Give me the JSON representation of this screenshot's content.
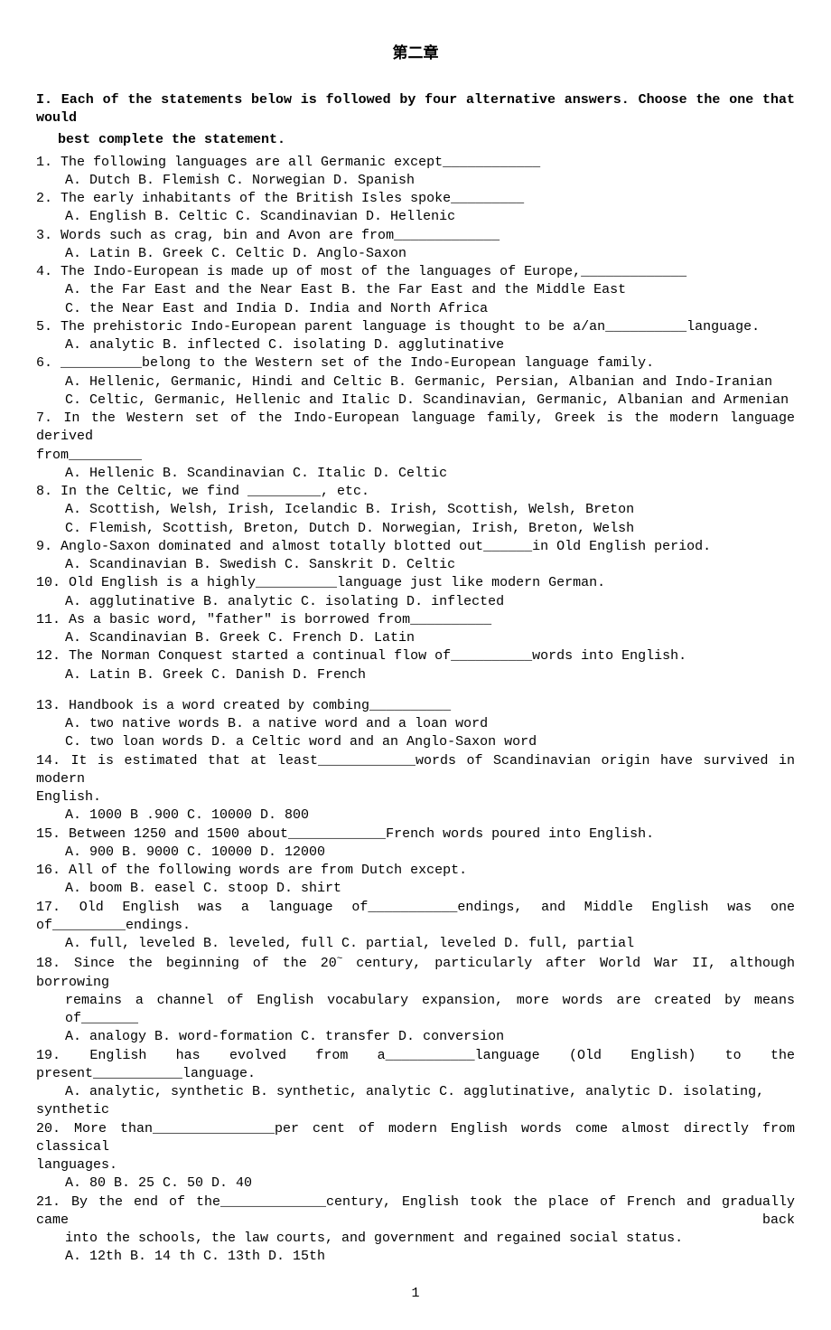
{
  "title": "第二章",
  "instructions_l1": "I. Each of the statements below is followed by four alternative answers. Choose the one that would",
  "instructions_l2": "best complete the statement.",
  "q1": {
    "stem": "1. The following languages are all Germanic except____________",
    "opts": "A. Dutch      B. Flemish       C. Norwegian      D. Spanish"
  },
  "q2": {
    "stem": "2. The early inhabitants of the British Isles spoke_________",
    "opts": "A. English     B. Celtic      C. Scandinavian     D. Hellenic"
  },
  "q3": {
    "stem": "3. Words such as crag, bin and Avon are from_____________",
    "opts": "A. Latin    B. Greek     C. Celtic    D. Anglo-Saxon"
  },
  "q4": {
    "stem": "4. The Indo-European is made up of most of the languages of Europe,_____________",
    "opts1": "A. the Far East and the Near East     B. the Far East and the Middle East",
    "opts2": "C. the Near East and India           D. India and North Africa"
  },
  "q5": {
    "stem": "5. The prehistoric Indo-European parent language is thought to be a/an__________language.",
    "opts": "A. analytic     B. inflected    C. isolating    D. agglutinative"
  },
  "q6": {
    "stem": "6. __________belong to the Western set of the Indo-European language family.",
    "opts1": "A. Hellenic, Germanic, Hindi and Celtic    B. Germanic, Persian, Albanian and Indo-Iranian",
    "opts2": "C. Celtic, Germanic, Hellenic and Italic   D. Scandinavian, Germanic, Albanian and Armenian"
  },
  "q7": {
    "stem1": "7. In the Western set of the Indo-European language family, Greek is the modern language derived",
    "stem2": "from_________",
    "opts": "A. Hellenic    B. Scandinavian    C. Italic    D. Celtic"
  },
  "q8": {
    "stem": "8. In the Celtic, we find _________, etc.",
    "opts1": "A. Scottish, Welsh, Irish, Icelandic     B. Irish, Scottish, Welsh, Breton",
    "opts2": "C. Flemish, Scottish, Breton, Dutch     D. Norwegian, Irish, Breton, Welsh"
  },
  "q9": {
    "stem": "9. Anglo-Saxon dominated  and  almost  totally  blotted  out______in Old English period.",
    "opts": "A. Scandinavian    B. Swedish    C. Sanskrit    D. Celtic"
  },
  "q10": {
    "stem": "10. Old English is a highly__________language just like modern German.",
    "opts": "A. agglutinative     B. analytic    C. isolating     D. inflected"
  },
  "q11": {
    "stem": "11. As a basic word, \"father\" is borrowed from__________",
    "opts": "A. Scandinavian     B. Greek     C. French     D. Latin"
  },
  "q12": {
    "stem": "12. The Norman Conquest started a continual flow of__________words into English.",
    "opts": "A. Latin     B. Greek     C. Danish     D. French"
  },
  "q13": {
    "stem": "13. Handbook is a word created by combing__________",
    "opts1": "A. two native words      B. a native word and a loan word",
    "opts2": "C. two loan words        D. a Celtic word and an Anglo-Saxon word"
  },
  "q14": {
    "stem1": "14. It is estimated that at least____________words of Scandinavian origin have survived in modern",
    "stem2": "English.",
    "opts": "A. 1000    B .900     C. 10000     D. 800"
  },
  "q15": {
    "stem": "15. Between 1250 and 1500 about____________French words poured into English.",
    "opts": "A. 900     B. 9000    C. 10000     D. 12000"
  },
  "q16": {
    "stem": "16. All of the following words are from Dutch except.",
    "opts": "A. boom    B. easel     C. stoop     D. shirt"
  },
  "q17": {
    "stem": "17. Old English was a language of___________endings, and Middle English was one of_________endings.",
    "opts": "A. full, leveled     B. leveled, full     C. partial, leveled    D. full, partial"
  },
  "q18": {
    "stem1": "18. Since the beginning of the 20",
    "sup": "~",
    "stem1b": " century, particularly after World War II, although borrowing",
    "stem2": "remains a channel of English vocabulary expansion, more words are created by means of_______",
    "opts": "A. analogy    B. word-formation    C. transfer     D. conversion"
  },
  "q19": {
    "stem": "19. English has evolved from a___________language (Old English) to the present___________language.",
    "opts1": "A. analytic, synthetic    B. synthetic, analytic   C. agglutinative, analytic   D. isolating,",
    "opts2": "synthetic"
  },
  "q20": {
    "stem1": "20. More than_______________per cent of modern English words come almost directly from classical",
    "stem2": "languages.",
    "opts": "A. 80     B. 25    C. 50    D. 40"
  },
  "q21": {
    "stem1": "21. By the end of the_____________century, English took the place of French and gradually came back",
    "stem2": "into the schools, the law courts, and government and regained social status.",
    "opts": "A. 12th    B. 14 th     C. 13th    D. 15th"
  },
  "pagenum": "1"
}
